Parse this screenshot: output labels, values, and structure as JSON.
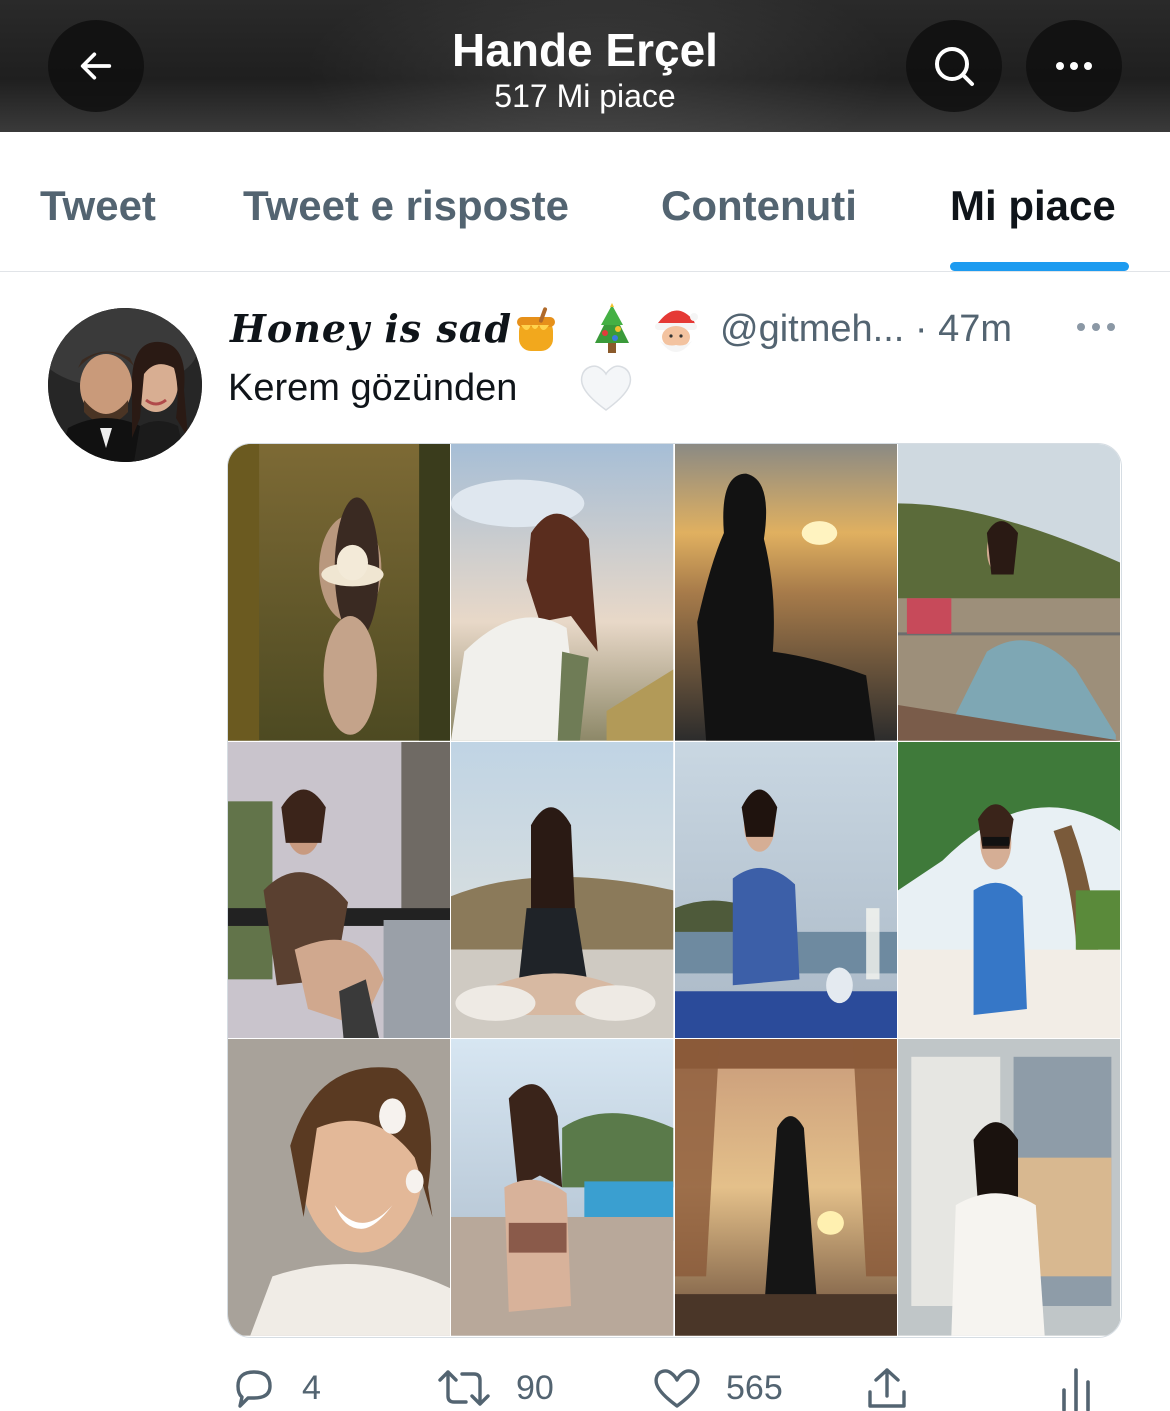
{
  "header": {
    "title": "Hande Erçel",
    "subtitle": "517 Mi piace",
    "back_icon": "arrow-left-icon",
    "search_icon": "search-icon",
    "more_icon": "more-horizontal-icon"
  },
  "tabs": [
    {
      "label": "Tweet",
      "active": false
    },
    {
      "label": "Tweet e risposte",
      "active": false
    },
    {
      "label": "Contenuti",
      "active": false
    },
    {
      "label": "Mi piace",
      "active": true
    }
  ],
  "tweet": {
    "display_name": "Honey is sad",
    "name_emojis": [
      "honey-pot-emoji",
      "christmas-tree-emoji",
      "santa-emoji"
    ],
    "handle": "@gitmeh...",
    "time": "· 47m",
    "text": "Kerem gözünden",
    "text_emoji": "white-heart-emoji",
    "media_count": 12,
    "actions": {
      "reply": {
        "icon": "reply-icon",
        "count": "4"
      },
      "retweet": {
        "icon": "retweet-icon",
        "count": "90"
      },
      "like": {
        "icon": "heart-icon",
        "count": "565"
      },
      "share": {
        "icon": "share-icon"
      },
      "analytics": {
        "icon": "analytics-icon"
      }
    }
  },
  "colors": {
    "accent": "#1d9bf0",
    "text_primary": "#0f1419",
    "text_secondary": "#536471",
    "header_bg": "#1f1f1f"
  }
}
